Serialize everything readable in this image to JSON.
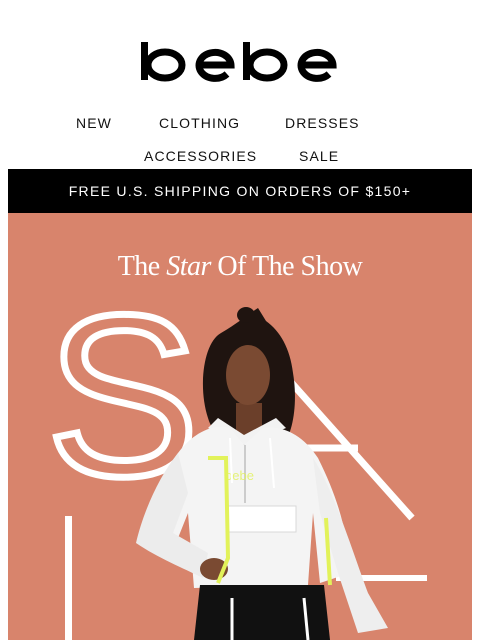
{
  "brand": {
    "logo_text": "bebe"
  },
  "nav": {
    "items": [
      {
        "label": "NEW"
      },
      {
        "label": "CLOTHING"
      },
      {
        "label": "DRESSES"
      },
      {
        "label": "ACCESSORIES"
      },
      {
        "label": "SALE"
      }
    ]
  },
  "banner": {
    "text": "FREE U.S. SHIPPING ON ORDERS OF $150+"
  },
  "hero": {
    "title_pre": "The",
    "title_star": "Star",
    "title_post": "Of The Show",
    "big_letters": [
      "S",
      "A",
      "L",
      "E"
    ],
    "jacket_logo_text": "bebe"
  },
  "colors": {
    "hero_background": "#d8846c",
    "banner_background": "#000000",
    "accent_neon": "#e2f25a"
  }
}
